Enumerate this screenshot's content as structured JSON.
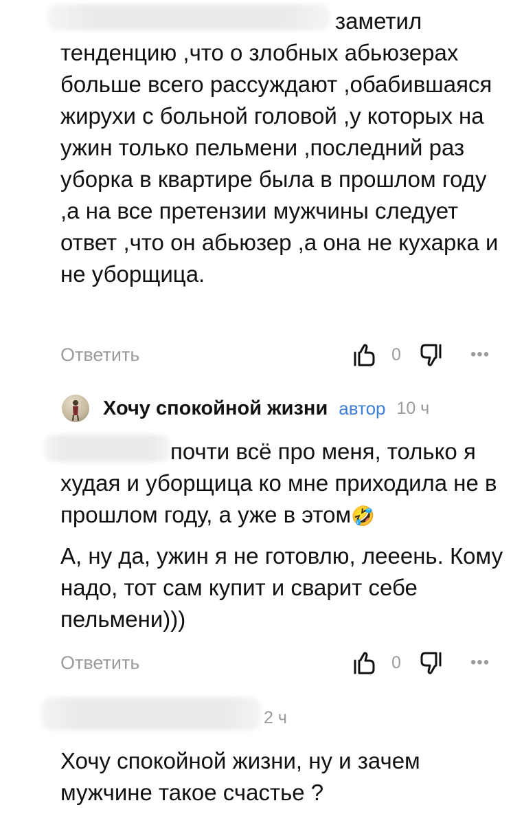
{
  "comment1": {
    "text": "заметил тенденцию ,что о злобных абьюзерах больше всего рассуждают ,обабившаяся жирухи с больной головой ,у которых на ужин только пельмени ,последний раз уборка в квартире была в прошлом году ,а на все претензии мужчины следует ответ ,что он абьюзер ,а она не кухарка и не уборщица.",
    "actions": {
      "reply_label": "Ответить",
      "like_count": "0",
      "more_label": "•••"
    }
  },
  "comment2": {
    "author": {
      "name": "Хочу спокойной жизни",
      "badge": "автор",
      "time": "10 ч"
    },
    "paragraph1": "почти всё про меня, только я худая и уборщица ко мне приходила не в прошлом году, а уже в этом",
    "emoji": "🤣",
    "paragraph2": "А, ну да, ужин я не готовлю, лееень. Кому надо, тот сам купит и сварит себе пельмени)))",
    "actions": {
      "reply_label": "Ответить",
      "like_count": "0",
      "more_label": "•••"
    }
  },
  "comment3": {
    "time": "2 ч",
    "text": "Хочу спокойной жизни, ну и зачем мужчине такое счастье ?"
  },
  "colors": {
    "text": "#111111",
    "muted": "#9b9b9b",
    "accent": "#3b7fd6",
    "redacted": "#ebebeb"
  }
}
